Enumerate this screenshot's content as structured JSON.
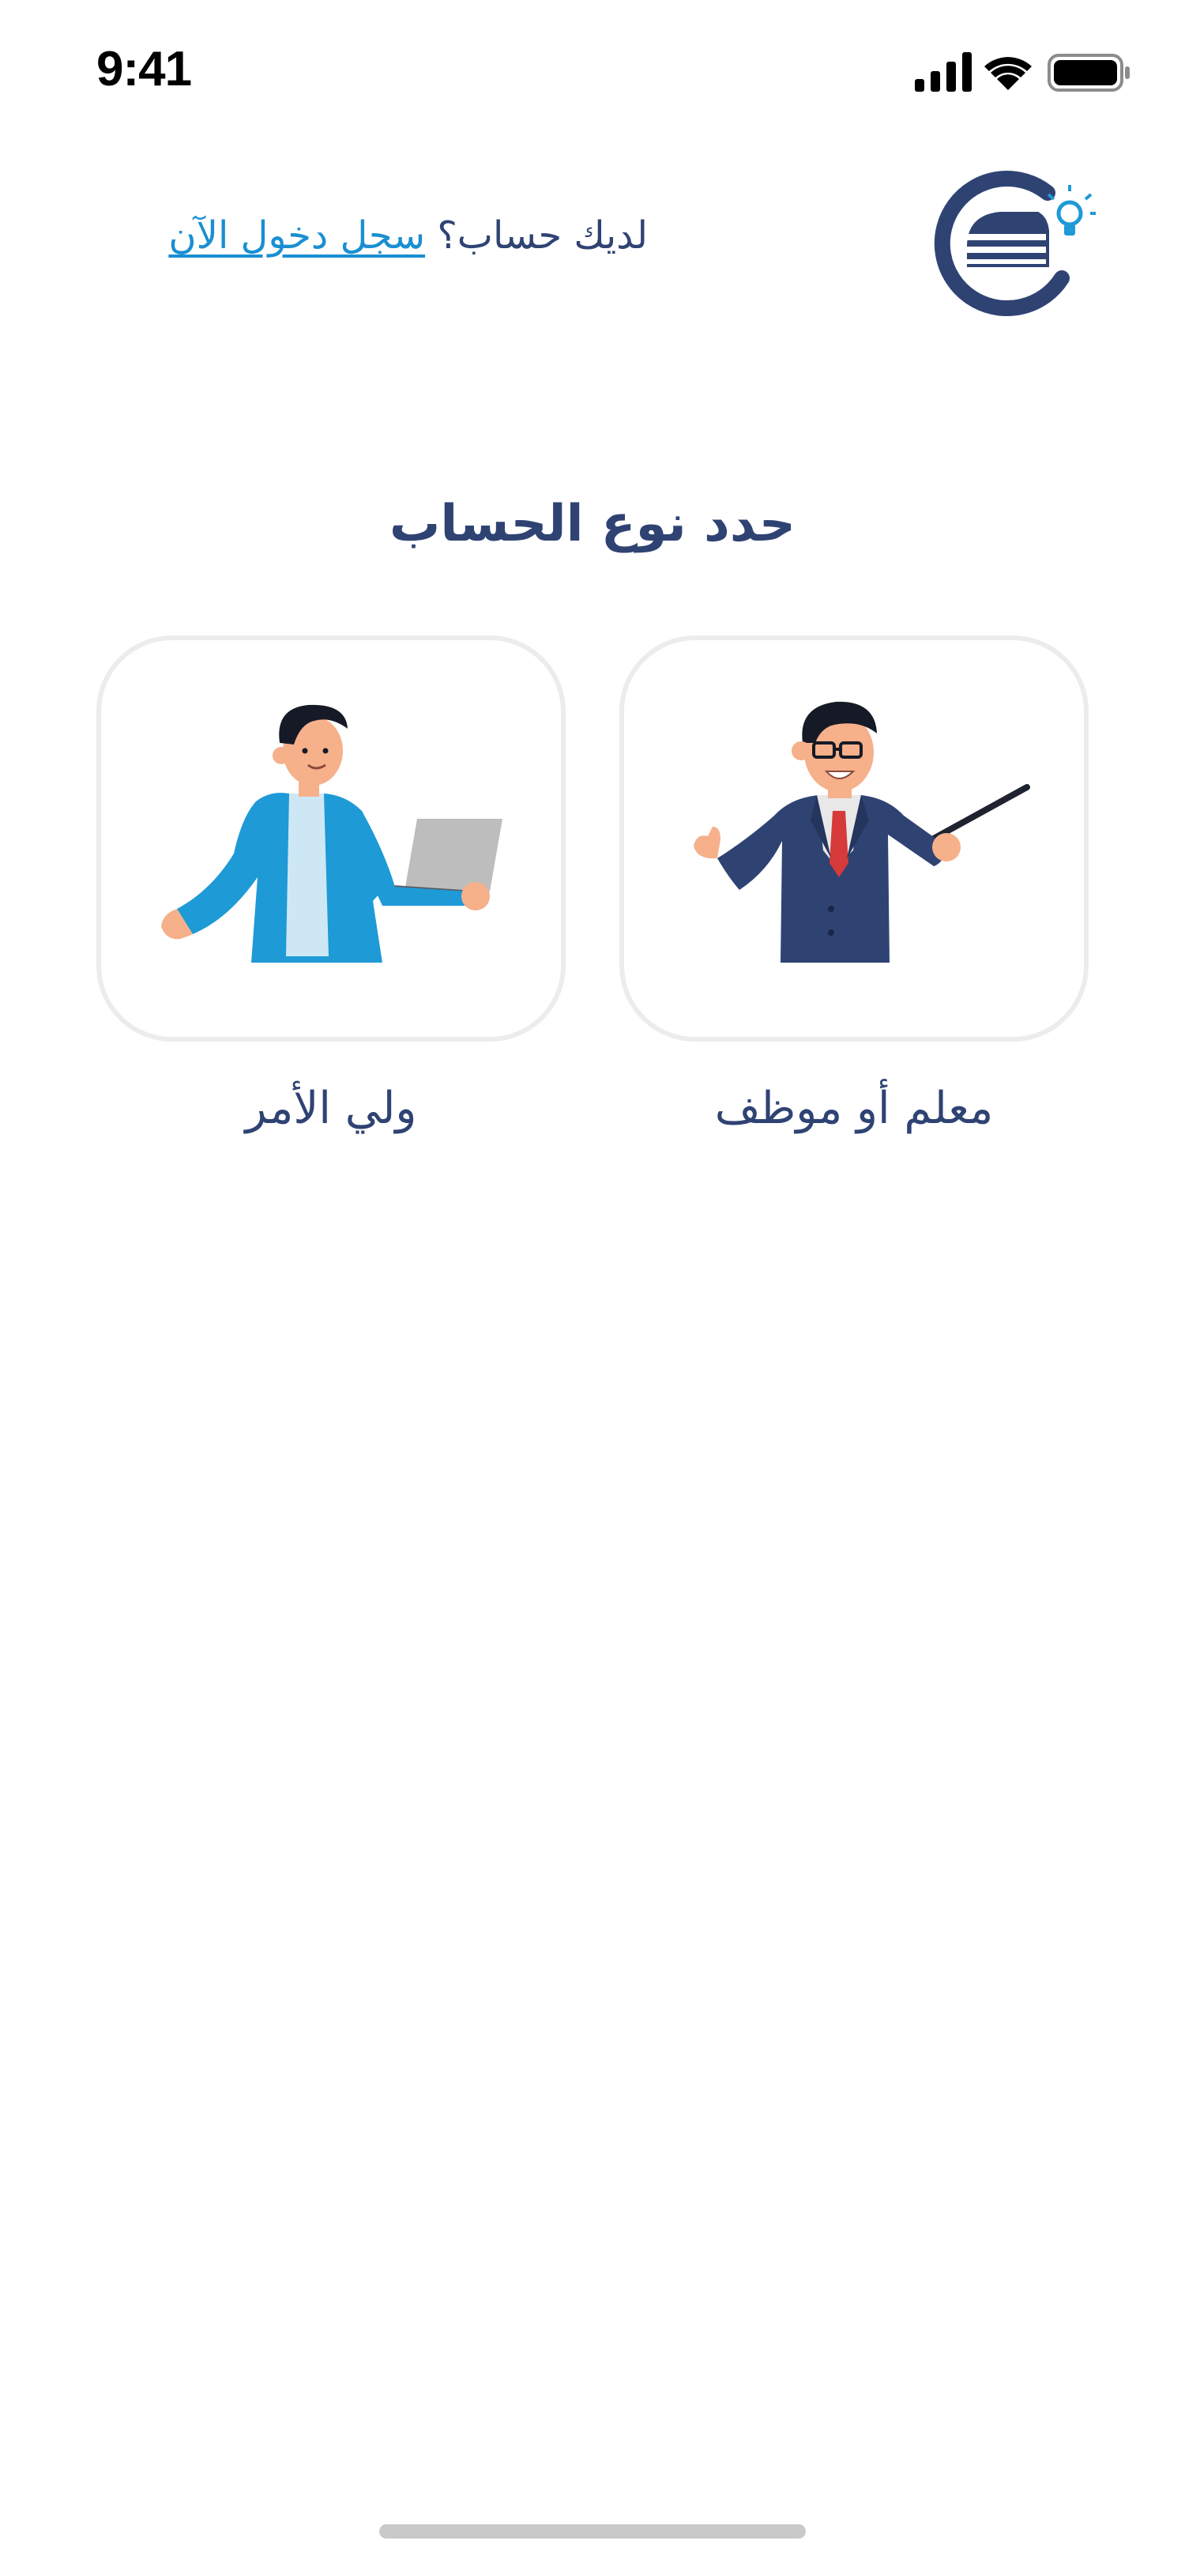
{
  "status_bar": {
    "time": "9:41",
    "icons": [
      "signal-icon",
      "wifi-icon",
      "battery-icon"
    ]
  },
  "header": {
    "prompt_text": "لديك حساب؟",
    "login_link": "سجل دخول الآن",
    "logo_icon": "books-lightbulb-logo"
  },
  "title": "حدد نوع الحساب",
  "account_types": [
    {
      "label": "معلم أو موظف",
      "icon": "teacher-illustration"
    },
    {
      "label": "ولي الأمر",
      "icon": "parent-illustration"
    }
  ],
  "colors": {
    "primary": "#2f4373",
    "link": "#1a8fd1",
    "card_border": "#ececec",
    "accent_blue": "#1e9ad6"
  }
}
